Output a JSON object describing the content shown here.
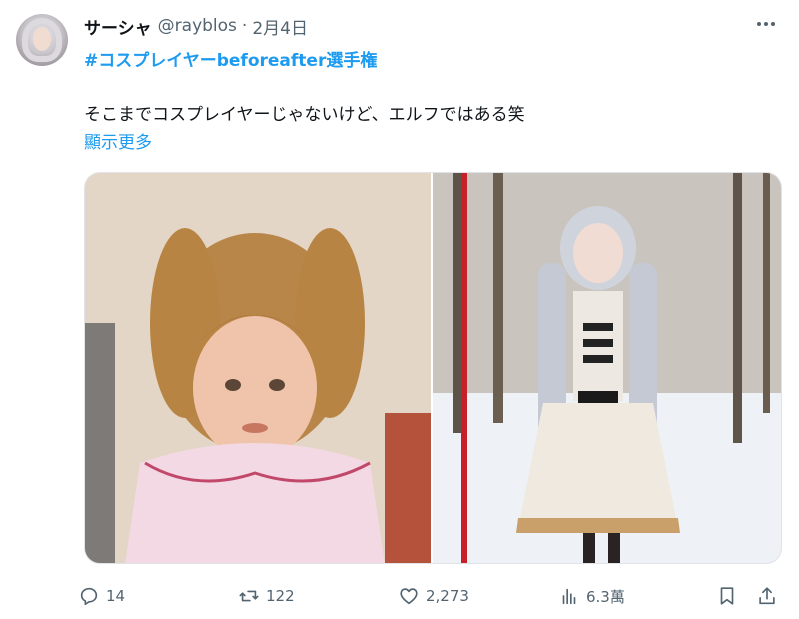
{
  "author": {
    "display_name": "サーシャ",
    "handle": "@rayblos",
    "separator": "·",
    "date": "2月4日"
  },
  "tweet": {
    "hashtag": "#コスプレイヤーbeforeafter選手権",
    "text": "そこまでコスプレイヤーじゃないけど、エルフではある笑",
    "show_more": "顯示更多"
  },
  "media": {
    "images": [
      {
        "kind": "before-childhood-photo"
      },
      {
        "kind": "after-elf-cosplay-photo"
      }
    ]
  },
  "actions": {
    "replies": "14",
    "reposts": "122",
    "likes": "2,273",
    "views": "6.3萬"
  },
  "icons": [
    "more-icon",
    "reply-icon",
    "repost-icon",
    "like-icon",
    "views-icon",
    "bookmark-icon",
    "share-icon"
  ],
  "colors": {
    "link": "#1d9bf0",
    "muted": "#536471",
    "text": "#0f1419"
  }
}
